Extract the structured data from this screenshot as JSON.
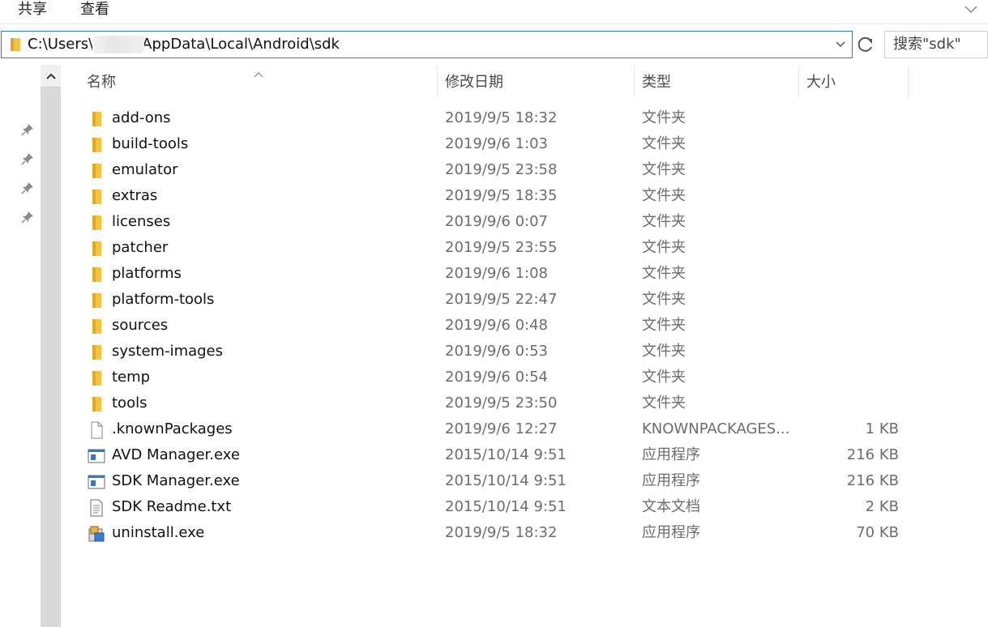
{
  "ribbon": {
    "tabs": [
      "共享",
      "查看"
    ]
  },
  "address": {
    "path_prefix": "C:\\Users\\",
    "path_suffix": "AppData\\Local\\Android\\sdk",
    "icon": "folder-icon"
  },
  "search": {
    "placeholder": "搜索\"sdk\""
  },
  "columns": {
    "name": "名称",
    "date": "修改日期",
    "type": "类型",
    "size": "大小"
  },
  "colors": {
    "folder": "#f5c242",
    "accent": "#2b79d6"
  },
  "files": [
    {
      "name": "add-ons",
      "date": "2019/9/5 18:32",
      "type": "文件夹",
      "size": "",
      "icon": "folder-icon"
    },
    {
      "name": "build-tools",
      "date": "2019/9/6 1:03",
      "type": "文件夹",
      "size": "",
      "icon": "folder-icon"
    },
    {
      "name": "emulator",
      "date": "2019/9/5 23:58",
      "type": "文件夹",
      "size": "",
      "icon": "folder-icon"
    },
    {
      "name": "extras",
      "date": "2019/9/5 18:35",
      "type": "文件夹",
      "size": "",
      "icon": "folder-icon"
    },
    {
      "name": "licenses",
      "date": "2019/9/6 0:07",
      "type": "文件夹",
      "size": "",
      "icon": "folder-icon"
    },
    {
      "name": "patcher",
      "date": "2019/9/5 23:55",
      "type": "文件夹",
      "size": "",
      "icon": "folder-icon"
    },
    {
      "name": "platforms",
      "date": "2019/9/6 1:08",
      "type": "文件夹",
      "size": "",
      "icon": "folder-icon"
    },
    {
      "name": "platform-tools",
      "date": "2019/9/5 22:47",
      "type": "文件夹",
      "size": "",
      "icon": "folder-icon"
    },
    {
      "name": "sources",
      "date": "2019/9/6 0:48",
      "type": "文件夹",
      "size": "",
      "icon": "folder-icon"
    },
    {
      "name": "system-images",
      "date": "2019/9/6 0:53",
      "type": "文件夹",
      "size": "",
      "icon": "folder-icon"
    },
    {
      "name": "temp",
      "date": "2019/9/6 0:54",
      "type": "文件夹",
      "size": "",
      "icon": "folder-icon"
    },
    {
      "name": "tools",
      "date": "2019/9/5 23:50",
      "type": "文件夹",
      "size": "",
      "icon": "folder-icon"
    },
    {
      "name": ".knownPackages",
      "date": "2019/9/6 12:27",
      "type": "KNOWNPACKAGES...",
      "size": "1 KB",
      "icon": "file-icon"
    },
    {
      "name": "AVD Manager.exe",
      "date": "2015/10/14 9:51",
      "type": "应用程序",
      "size": "216 KB",
      "icon": "app-window-icon"
    },
    {
      "name": "SDK Manager.exe",
      "date": "2015/10/14 9:51",
      "type": "应用程序",
      "size": "216 KB",
      "icon": "app-window-icon"
    },
    {
      "name": "SDK Readme.txt",
      "date": "2015/10/14 9:51",
      "type": "文本文档",
      "size": "2 KB",
      "icon": "text-file-icon"
    },
    {
      "name": "uninstall.exe",
      "date": "2019/9/5 18:32",
      "type": "应用程序",
      "size": "70 KB",
      "icon": "installer-icon"
    }
  ]
}
